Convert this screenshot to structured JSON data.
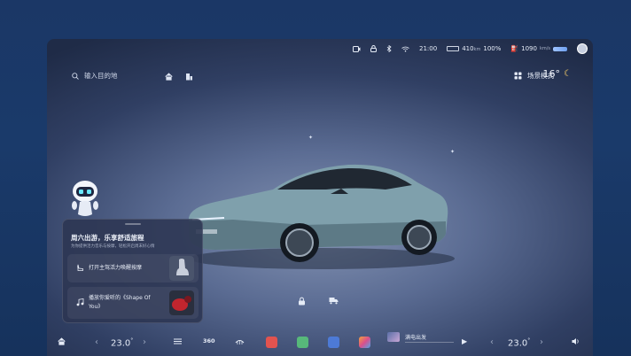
{
  "status_bar": {
    "time": "21:00",
    "range_km": "410",
    "range_unit": "km",
    "battery_percent": "100",
    "battery_unit": "%",
    "power": "1090",
    "power_unit": "km/s"
  },
  "search": {
    "placeholder": "输入目的地"
  },
  "scene_mode": {
    "label": "场景模式"
  },
  "weather": {
    "temperature": "16°"
  },
  "recommendation_card": {
    "title": "周六出游，乐享舒适旅程",
    "subtitle": "为你提供活力音乐与按摩，轻松开启周末好心情",
    "items": [
      {
        "label": "打开主驾活力唤醒按摩"
      },
      {
        "label_line1": "播放你爱听的《Shape Of",
        "label_line2": "You》"
      }
    ]
  },
  "dock": {
    "left_temp": "23.0",
    "left_temp_unit": "°",
    "right_temp": "23.0",
    "right_temp_unit": "°",
    "view_360": "360",
    "media_title": "满电出发"
  },
  "colors": {
    "accent": "#8fb4ff",
    "card_bg": "#2c3652"
  },
  "icons": [
    "home-icon",
    "search-icon",
    "map-pin-icon",
    "building-icon",
    "scene-icon",
    "moon-icon",
    "camera-icon",
    "lock-icon",
    "bluetooth-icon",
    "wifi-icon",
    "user-icon",
    "seat-icon",
    "music-icon",
    "robot-icon",
    "car-lock-icon",
    "truck-icon",
    "fan-icon",
    "defrost-icon",
    "app-music-icon",
    "phone-icon",
    "calendar-icon",
    "apps-icon",
    "play-icon",
    "volume-icon"
  ]
}
